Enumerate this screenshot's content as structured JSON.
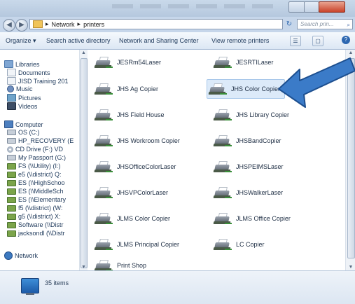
{
  "address": {
    "crumbs": [
      "Network",
      "printers"
    ],
    "search_placeholder": "Search prin..."
  },
  "toolbar": {
    "organize": "Organize ▾",
    "search_ad": "Search active directory",
    "network_sharing": "Network and Sharing Center",
    "view_remote": "View remote printers"
  },
  "nav": {
    "libraries": "Libraries",
    "documents": "Documents",
    "jisd_training": "JISD Training 201",
    "music": "Music",
    "pictures": "Pictures",
    "videos": "Videos",
    "computer": "Computer",
    "os": "OS (C:)",
    "hp_recovery": "HP_RECOVERY (E",
    "cd_drive": "CD Drive (F:) VD",
    "my_passport": "My Passport (G:)",
    "utility": "FS (\\\\Utility) (I:)",
    "e5_district": "e5 (\\\\district) Q:",
    "es_highschool": "ES (\\\\HighSchoo",
    "es_middleschool": "ES (\\\\MiddleSch",
    "es_elementary": "ES (\\\\Elementary",
    "f5_district": "f5 (\\\\district) (W:",
    "g5_district": "g5 (\\\\district) X:",
    "software": "Software (\\\\Distr",
    "jacksondl": "jacksondl (\\\\Distr",
    "network": "Network"
  },
  "printers": [
    "JESRm54Laser",
    "JESRTILaser",
    "JHS Ag Copier",
    "JHS Color Copier",
    "JHS Field House",
    "JHS Library Copier",
    "JHS Workroom Copier",
    "JHSBandCopier",
    "JHSOfficeColorLaser",
    "JHSPEIMSLaser",
    "JHSVPColorLaser",
    "JHSWalkerLaser",
    "JLMS Color Copier",
    "JLMS Office Copier",
    "JLMS Principal Copier",
    "LC Copier",
    "Print Shop"
  ],
  "status": {
    "count": "35 items"
  },
  "colors": {
    "arrow": "#3b7bc8",
    "arrow_border": "#1d4f8f",
    "selection": "#dceaf9"
  }
}
